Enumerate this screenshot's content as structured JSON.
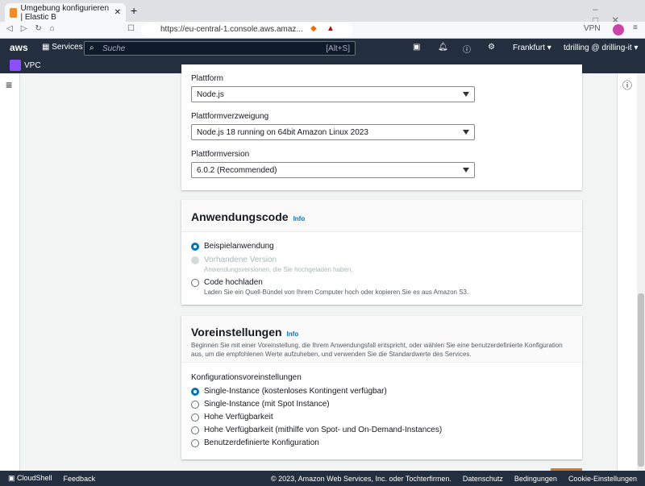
{
  "browser": {
    "tab_title": "Umgebung konfigurieren | Elastic B",
    "url": "https://eu-central-1.console.aws.amaz...",
    "vpn": "VPN"
  },
  "nav": {
    "logo": "aws",
    "services": "Services",
    "search_placeholder": "Suche",
    "search_shortcut": "[Alt+S]",
    "region": "Frankfurt ▾",
    "user": "tdrilling @ drilling-it ▾",
    "service_shortcut": "VPC"
  },
  "platform": {
    "platform_label": "Plattform",
    "platform_value": "Node.js",
    "branch_label": "Plattformverzweigung",
    "branch_value": "Node.js 18 running on 64bit Amazon Linux 2023",
    "version_label": "Plattformversion",
    "version_value": "6.0.2 (Recommended)"
  },
  "code": {
    "title": "Anwendungscode",
    "info": "Info",
    "options": [
      {
        "label": "Beispielanwendung",
        "desc": ""
      },
      {
        "label": "Vorhandene Version",
        "desc": "Anwendungsversionen, die Sie hochgeladen haben."
      },
      {
        "label": "Code hochladen",
        "desc": "Laden Sie ein Quell-Bündel von Ihrem Computer hoch oder kopieren Sie es aus Amazon S3."
      }
    ]
  },
  "presets": {
    "title": "Voreinstellungen",
    "info": "Info",
    "desc": "Beginnen Sie mit einer Voreinstellung, die Ihrem Anwendungsfall entspricht, oder wählen Sie eine benutzerdefinierte Konfiguration aus, um die empfohlenen Werte aufzuheben, und verwenden Sie die Standardwerte des Services.",
    "group_label": "Konfigurationsvoreinstellungen",
    "options": [
      "Single-Instance (kostenloses Kontingent verfügbar)",
      "Single-Instance (mit Spot Instance)",
      "Hohe Verfügbarkeit",
      "Hohe Verfügbarkeit (mithilfe von Spot- und On-Demand-Instances)",
      "Benutzerdefinierte Konfiguration"
    ]
  },
  "footer": {
    "cloudshell": "CloudShell",
    "feedback": "Feedback",
    "copyright": "© 2023, Amazon Web Services, Inc. oder Tochterfirmen.",
    "privacy": "Datenschutz",
    "terms": "Bedingungen",
    "cookies": "Cookie-Einstellungen"
  }
}
